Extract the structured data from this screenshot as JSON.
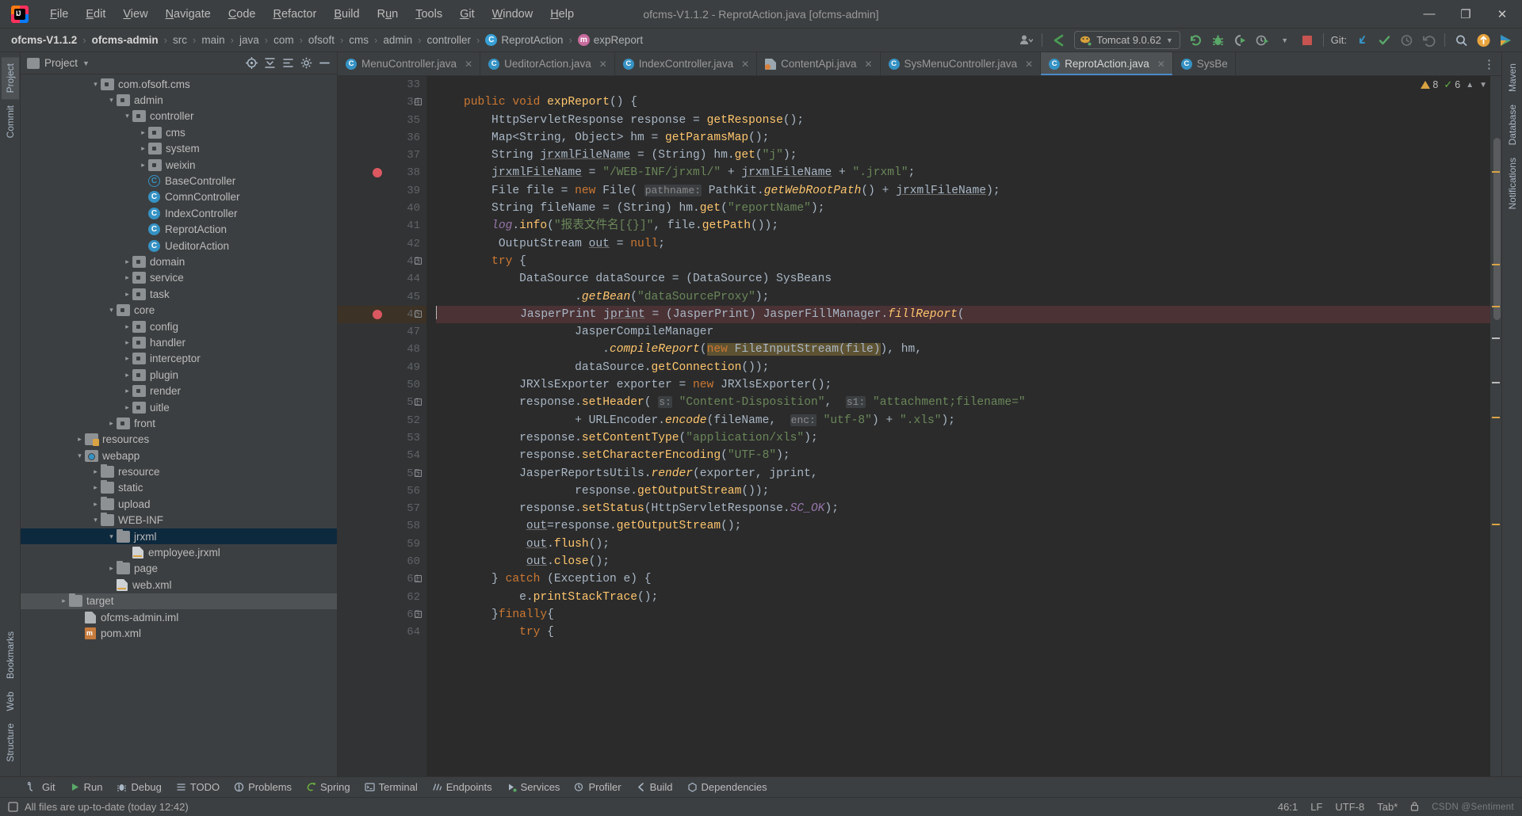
{
  "window": {
    "title": "ofcms-V1.1.2 - ReprotAction.java [ofcms-admin]",
    "minimize": "—",
    "maximize": "❐",
    "close": "✕"
  },
  "menubar": {
    "items": [
      {
        "label": "File"
      },
      {
        "label": "Edit"
      },
      {
        "label": "View"
      },
      {
        "label": "Navigate"
      },
      {
        "label": "Code"
      },
      {
        "label": "Refactor"
      },
      {
        "label": "Build"
      },
      {
        "label": "Run"
      },
      {
        "label": "Tools"
      },
      {
        "label": "Git"
      },
      {
        "label": "Window"
      },
      {
        "label": "Help"
      }
    ]
  },
  "navbar": {
    "breadcrumbs": [
      {
        "label": "ofcms-V1.1.2",
        "icon": "",
        "bold": true
      },
      {
        "label": "ofcms-admin",
        "icon": "",
        "bold": true
      },
      {
        "label": "src",
        "icon": ""
      },
      {
        "label": "main",
        "icon": ""
      },
      {
        "label": "java",
        "icon": ""
      },
      {
        "label": "com",
        "icon": ""
      },
      {
        "label": "ofsoft",
        "icon": ""
      },
      {
        "label": "cms",
        "icon": ""
      },
      {
        "label": "admin",
        "icon": ""
      },
      {
        "label": "controller",
        "icon": ""
      },
      {
        "label": "ReprotAction",
        "icon": "class-icon"
      },
      {
        "label": "expReport",
        "icon": "method-icon"
      }
    ],
    "separator": "›",
    "run_config": "Tomcat 9.0.62",
    "git_label": "Git:",
    "toolbar_icons": [
      "user-avatar-icon",
      "checkout-icon",
      "rerun-icon",
      "debug-icon",
      "run-with-coverage-icon",
      "profiler-icon",
      "stop-icon",
      "update-project-icon",
      "commit-icon",
      "history-icon",
      "rollback-icon",
      "search-everywhere-icon",
      "ai-assistant-icon",
      "run-anything-icon"
    ]
  },
  "left_rail": {
    "items": [
      {
        "label": "Project",
        "active": true,
        "icon": "project-icon"
      },
      {
        "label": "Commit",
        "active": false,
        "icon": "commit-icon"
      },
      {
        "label": "Bookmarks",
        "active": false,
        "icon": "bookmark-icon"
      },
      {
        "label": "Web",
        "active": false,
        "icon": "web-icon"
      },
      {
        "label": "Structure",
        "active": false,
        "icon": "structure-icon"
      }
    ]
  },
  "right_rail": {
    "items": [
      {
        "label": "Maven",
        "icon": "maven-icon"
      },
      {
        "label": "Database",
        "icon": "database-icon"
      },
      {
        "label": "Notifications",
        "icon": "notifications-icon"
      }
    ]
  },
  "project_panel": {
    "title": "Project",
    "dropdown": "▾",
    "tools": [
      "locate-icon",
      "collapse-all-icon",
      "expand-all-icon",
      "settings-icon",
      "hide-icon"
    ],
    "tree": [
      {
        "indent": 4,
        "arrow": "down",
        "icon": "package",
        "label": "com.ofsoft.cms"
      },
      {
        "indent": 5,
        "arrow": "down",
        "icon": "package",
        "label": "admin"
      },
      {
        "indent": 6,
        "arrow": "down",
        "icon": "package",
        "label": "controller"
      },
      {
        "indent": 7,
        "arrow": "right",
        "icon": "package",
        "label": "cms"
      },
      {
        "indent": 7,
        "arrow": "right",
        "icon": "package",
        "label": "system"
      },
      {
        "indent": 7,
        "arrow": "right",
        "icon": "package",
        "label": "weixin"
      },
      {
        "indent": 7,
        "arrow": "none",
        "icon": "class-abstract",
        "label": "BaseController"
      },
      {
        "indent": 7,
        "arrow": "none",
        "icon": "class",
        "label": "ComnController"
      },
      {
        "indent": 7,
        "arrow": "none",
        "icon": "class",
        "label": "IndexController"
      },
      {
        "indent": 7,
        "arrow": "none",
        "icon": "class",
        "label": "ReprotAction"
      },
      {
        "indent": 7,
        "arrow": "none",
        "icon": "class",
        "label": "UeditorAction"
      },
      {
        "indent": 6,
        "arrow": "right",
        "icon": "package",
        "label": "domain"
      },
      {
        "indent": 6,
        "arrow": "right",
        "icon": "package",
        "label": "service"
      },
      {
        "indent": 6,
        "arrow": "right",
        "icon": "package",
        "label": "task"
      },
      {
        "indent": 5,
        "arrow": "down",
        "icon": "package",
        "label": "core"
      },
      {
        "indent": 6,
        "arrow": "right",
        "icon": "package",
        "label": "config"
      },
      {
        "indent": 6,
        "arrow": "right",
        "icon": "package",
        "label": "handler"
      },
      {
        "indent": 6,
        "arrow": "right",
        "icon": "package",
        "label": "interceptor"
      },
      {
        "indent": 6,
        "arrow": "right",
        "icon": "package",
        "label": "plugin"
      },
      {
        "indent": 6,
        "arrow": "right",
        "icon": "package",
        "label": "render"
      },
      {
        "indent": 6,
        "arrow": "right",
        "icon": "package",
        "label": "uitle"
      },
      {
        "indent": 5,
        "arrow": "right",
        "icon": "package",
        "label": "front"
      },
      {
        "indent": 3,
        "arrow": "right",
        "icon": "resources",
        "label": "resources"
      },
      {
        "indent": 3,
        "arrow": "down",
        "icon": "webapp",
        "label": "webapp"
      },
      {
        "indent": 4,
        "arrow": "right",
        "icon": "folder",
        "label": "resource"
      },
      {
        "indent": 4,
        "arrow": "right",
        "icon": "folder",
        "label": "static"
      },
      {
        "indent": 4,
        "arrow": "right",
        "icon": "folder",
        "label": "upload"
      },
      {
        "indent": 4,
        "arrow": "down",
        "icon": "folder",
        "label": "WEB-INF"
      },
      {
        "indent": 5,
        "arrow": "down",
        "icon": "folder",
        "label": "jrxml",
        "selected": true
      },
      {
        "indent": 6,
        "arrow": "none",
        "icon": "jrxml",
        "label": "employee.jrxml"
      },
      {
        "indent": 5,
        "arrow": "right",
        "icon": "folder",
        "label": "page"
      },
      {
        "indent": 5,
        "arrow": "none",
        "icon": "xml",
        "label": "web.xml"
      },
      {
        "indent": 2,
        "arrow": "right",
        "icon": "folder-target",
        "label": "target",
        "highlight": true
      },
      {
        "indent": 3,
        "arrow": "none",
        "icon": "iml",
        "label": "ofcms-admin.iml"
      },
      {
        "indent": 3,
        "arrow": "none",
        "icon": "pom",
        "label": "pom.xml"
      }
    ]
  },
  "editor": {
    "tabs": [
      {
        "label": "MenuController.java",
        "icon": "class",
        "active": false
      },
      {
        "label": "UeditorAction.java",
        "icon": "class",
        "active": false
      },
      {
        "label": "IndexController.java",
        "icon": "class",
        "active": false
      },
      {
        "label": "ContentApi.java",
        "icon": "api",
        "active": false
      },
      {
        "label": "SysMenuController.java",
        "icon": "class",
        "active": false
      },
      {
        "label": "ReprotAction.java",
        "icon": "class",
        "active": true
      },
      {
        "label": "SysBe",
        "icon": "class",
        "active": false
      }
    ],
    "close_glyph": "✕",
    "inspection": {
      "warnings": "8",
      "weak_warnings": "6",
      "chevron_up": "⌃",
      "chevron_down": "⌄"
    },
    "first_line": 33,
    "breakpoint_lines": [
      38,
      46
    ],
    "highlight_line": 46,
    "lines": [
      {
        "n": 33,
        "html": ""
      },
      {
        "n": 34,
        "html": "    <span class='kw'>public</span> <span class='kw'>void</span> <span class='mth'>expReport</span>() {"
      },
      {
        "n": 35,
        "html": "        HttpServletResponse response = <span class='mth'>getResponse</span>();"
      },
      {
        "n": 36,
        "html": "        Map&lt;String, Object&gt; hm = <span class='mth'>getParamsMap</span>();"
      },
      {
        "n": 37,
        "html": "        String <span class='uline'>jrxmlFileName</span> = (String) hm.<span class='mth'>get</span>(<span class='str'>\"j\"</span>);"
      },
      {
        "n": 38,
        "html": "        <span class='uline'>jrxmlFileName</span> = <span class='str'>\"/WEB-INF/jrxml/\"</span> + <span class='uline'>jrxmlFileName</span> + <span class='str'>\".jrxml\"</span>;"
      },
      {
        "n": 39,
        "html": "        File file = <span class='kw'>new</span> File( <span class='param'>pathname:</span> PathKit.<span class='mth-i'>getWebRootPath</span>() + <span class='uline'>jrxmlFileName</span>);"
      },
      {
        "n": 40,
        "html": "        String fileName = (String) hm.<span class='mth'>get</span>(<span class='str'>\"reportName\"</span>);"
      },
      {
        "n": 41,
        "html": "        <span class='fld-i'>log</span>.<span class='mth'>info</span>(<span class='str'>\"报表文件名[{}]\"</span>, file.<span class='mth'>getPath</span>());"
      },
      {
        "n": 42,
        "html": "         OutputStream <span class='uline'>out</span> = <span class='kw'>null</span>;"
      },
      {
        "n": 43,
        "html": "        <span class='kw'>try</span> {"
      },
      {
        "n": 44,
        "html": "            DataSource dataSource = (DataSource) SysBeans"
      },
      {
        "n": 45,
        "html": "                    .<span class='mth-i'>getBean</span>(<span class='str'>\"dataSourceProxy\"</span>);"
      },
      {
        "n": 46,
        "html": "            JasperPrint <span class='uline'>jprint</span> = (JasperPrint) JasperFillManager.<span class='mth-i'>fillReport</span>("
      },
      {
        "n": 47,
        "html": "                    JasperCompileManager"
      },
      {
        "n": 48,
        "html": "                        .<span class='mth-i'>compileReport</span>(<span class='hlbox'><span class='kw'>new</span> FileInputStream(file)</span>), hm,"
      },
      {
        "n": 49,
        "html": "                    dataSource.<span class='mth'>getConnection</span>());"
      },
      {
        "n": 50,
        "html": "            JRXlsExporter exporter = <span class='kw'>new</span> JRXlsExporter();"
      },
      {
        "n": 51,
        "html": "            response.<span class='mth'>setHeader</span>( <span class='param'>s:</span> <span class='str'>\"Content-Disposition\"</span>,  <span class='param'>s1:</span> <span class='str'>\"attachment;filename=\"</span>"
      },
      {
        "n": 52,
        "html": "                    + URLEncoder.<span class='mth-i'>encode</span>(fileName,  <span class='param'>enc:</span> <span class='str'>\"utf-8\"</span>) + <span class='str'>\".xls\"</span>);"
      },
      {
        "n": 53,
        "html": "            response.<span class='mth'>setContentType</span>(<span class='str'>\"application/xls\"</span>);"
      },
      {
        "n": 54,
        "html": "            response.<span class='mth'>setCharacterEncoding</span>(<span class='str'>\"UTF-8\"</span>);"
      },
      {
        "n": 55,
        "html": "            JasperReportsUtils.<span class='mth-i'>render</span>(exporter, jprint,"
      },
      {
        "n": 56,
        "html": "                    response.<span class='mth'>getOutputStream</span>());"
      },
      {
        "n": 57,
        "html": "            response.<span class='mth'>setStatus</span>(HttpServletResponse.<span class='fld-i'>SC_OK</span>);"
      },
      {
        "n": 58,
        "html": "             <span class='uline'>out</span>=response.<span class='mth'>getOutputStream</span>();"
      },
      {
        "n": 59,
        "html": "             <span class='uline'>out</span>.<span class='mth'>flush</span>();"
      },
      {
        "n": 60,
        "html": "             <span class='uline'>out</span>.<span class='mth'>close</span>();"
      },
      {
        "n": 61,
        "html": "        } <span class='kw'>catch</span> (Exception e) {"
      },
      {
        "n": 62,
        "html": "            e.<span class='mth'>printStackTrace</span>();"
      },
      {
        "n": 63,
        "html": "        }<span class='kw'>finally</span>{"
      },
      {
        "n": 64,
        "html": "            <span class='kw'>try</span> {"
      }
    ]
  },
  "bottom_bar": {
    "items": [
      {
        "label": "Git",
        "icon": "git-icon"
      },
      {
        "label": "Run",
        "icon": "run-icon"
      },
      {
        "label": "Debug",
        "icon": "debug-icon"
      },
      {
        "label": "TODO",
        "icon": "todo-icon"
      },
      {
        "label": "Problems",
        "icon": "problems-icon"
      },
      {
        "label": "Spring",
        "icon": "spring-icon"
      },
      {
        "label": "Terminal",
        "icon": "terminal-icon"
      },
      {
        "label": "Endpoints",
        "icon": "endpoints-icon"
      },
      {
        "label": "Services",
        "icon": "services-icon"
      },
      {
        "label": "Profiler",
        "icon": "profiler-icon"
      },
      {
        "label": "Build",
        "icon": "build-icon"
      },
      {
        "label": "Dependencies",
        "icon": "dependencies-icon"
      }
    ]
  },
  "status_bar": {
    "message": "All files are up-to-date (today 12:42)",
    "caret_position": "46:1",
    "line_separator": "LF",
    "encoding": "UTF-8",
    "indent": "Tab*",
    "watermark": "CSDN @Sentiment"
  },
  "colors": {
    "accent": "#4a88c7",
    "background": "#3c3f41",
    "editor_background": "#2b2b2b",
    "selected_tree_row": "#0d293e",
    "breakpoint": "#db5860",
    "keyword": "#cc7832",
    "string": "#6a8759",
    "method": "#ffc66d",
    "field": "#9876aa",
    "highlight_line": "#4b3235"
  }
}
